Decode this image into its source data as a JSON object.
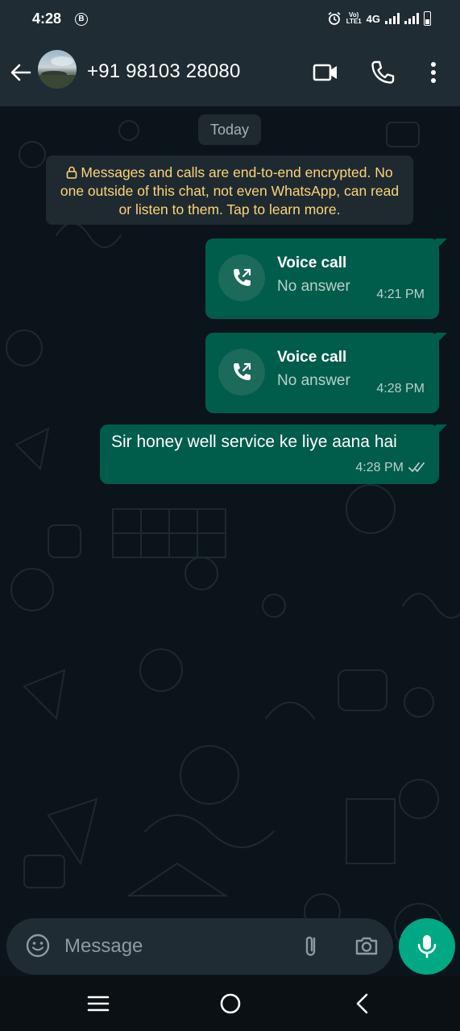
{
  "status_bar": {
    "time": "4:28",
    "b_icon": "B",
    "volte": "Vo))\nLTE1",
    "network": "4G",
    "icons": [
      "alarm-icon",
      "signal-icon",
      "battery-icon"
    ]
  },
  "header": {
    "contact_name": "+91 98103 28080",
    "icons": [
      "back-arrow-icon",
      "video-call-icon",
      "phone-icon",
      "more-icon"
    ]
  },
  "chat": {
    "date_chip": "Today",
    "encryption_notice": "Messages and calls are end-to-end encrypted. No one outside of this chat, not even WhatsApp, can read or listen to them. Tap to learn more.",
    "messages": [
      {
        "type": "call",
        "title": "Voice call",
        "status": "No answer",
        "time": "4:21 PM"
      },
      {
        "type": "call",
        "title": "Voice call",
        "status": "No answer",
        "time": "4:28 PM"
      },
      {
        "type": "text",
        "text": "Sir honey well service ke liye aana hai",
        "time": "4:28 PM",
        "read": true
      }
    ]
  },
  "composer": {
    "placeholder": "Message",
    "icons": [
      "emoji-icon",
      "attach-icon",
      "camera-icon",
      "mic-icon"
    ]
  },
  "colors": {
    "header_bg": "#1f2c34",
    "chat_bg": "#0b141a",
    "outgoing_bubble": "#005c4b",
    "accent": "#00a884",
    "notice_text": "#ffd279"
  }
}
